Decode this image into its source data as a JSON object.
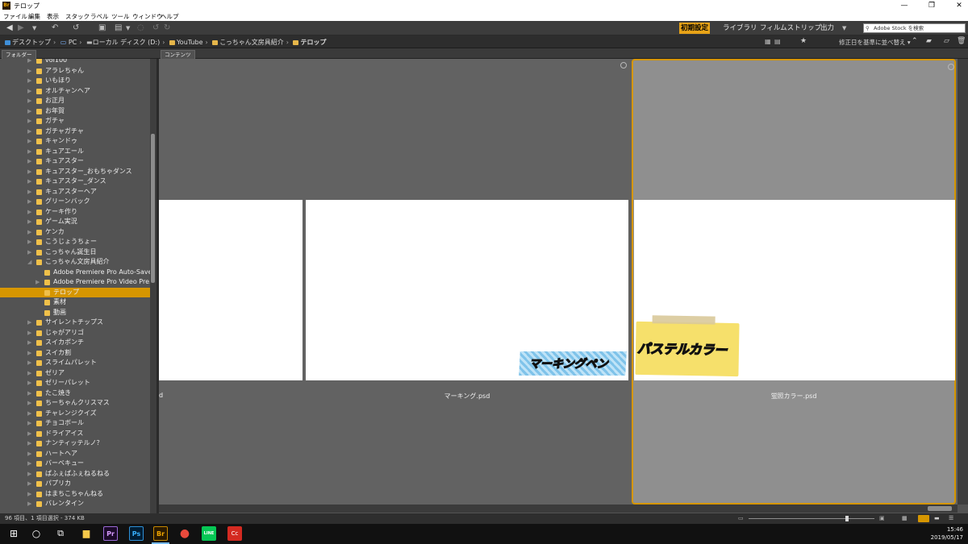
{
  "window": {
    "title": "テロップ",
    "app_icon_label": "Br",
    "controls": [
      "—",
      "❐",
      "✕"
    ]
  },
  "menu": [
    "ファイル",
    "編集",
    "表示",
    "スタック",
    "ラベル",
    "ツール",
    "ウィンドウ",
    "ヘルプ"
  ],
  "toolbar": {
    "workspaces": [
      "初期設定",
      "ライブラリ",
      "フィルムストリップ",
      "出力"
    ],
    "search_placeholder": "Adobe Stock を検索"
  },
  "breadcrumb": [
    "デスクトップ",
    "PC",
    "ローカル ディスク (D:)",
    "YouTube",
    "こっちゃん文房具紹介",
    "テロップ"
  ],
  "sort_label": "修正日を基準に並べ替え",
  "panels": {
    "folders_tab": "フォルダー",
    "content_tab": "コンテンツ"
  },
  "sidebar": {
    "items": [
      {
        "label": "vol100",
        "depth": 0,
        "expanded": false,
        "selected": false
      },
      {
        "label": "アラレちゃん",
        "depth": 0,
        "expanded": false,
        "selected": false
      },
      {
        "label": "いもほり",
        "depth": 0,
        "expanded": false,
        "selected": false
      },
      {
        "label": "オルチャンヘア",
        "depth": 0,
        "expanded": false,
        "selected": false
      },
      {
        "label": "お正月",
        "depth": 0,
        "expanded": false,
        "selected": false
      },
      {
        "label": "お年賀",
        "depth": 0,
        "expanded": false,
        "selected": false
      },
      {
        "label": "ガチャ",
        "depth": 0,
        "expanded": false,
        "selected": false
      },
      {
        "label": "ガチャガチャ",
        "depth": 0,
        "expanded": false,
        "selected": false
      },
      {
        "label": "キャンドゥ",
        "depth": 0,
        "expanded": false,
        "selected": false
      },
      {
        "label": "キュアエール",
        "depth": 0,
        "expanded": false,
        "selected": false
      },
      {
        "label": "キュアスター",
        "depth": 0,
        "expanded": false,
        "selected": false
      },
      {
        "label": "キュアスター_おもちゃダンス",
        "depth": 0,
        "expanded": false,
        "selected": false
      },
      {
        "label": "キュアスター_ダンス",
        "depth": 0,
        "expanded": false,
        "selected": false
      },
      {
        "label": "キュアスターヘア",
        "depth": 0,
        "expanded": false,
        "selected": false
      },
      {
        "label": "グリーンバック",
        "depth": 0,
        "expanded": false,
        "selected": false
      },
      {
        "label": "ケーキ作り",
        "depth": 0,
        "expanded": false,
        "selected": false
      },
      {
        "label": "ゲーム実況",
        "depth": 0,
        "expanded": false,
        "selected": false
      },
      {
        "label": "ケンカ",
        "depth": 0,
        "expanded": false,
        "selected": false
      },
      {
        "label": "こうじょうちょー",
        "depth": 0,
        "expanded": false,
        "selected": false
      },
      {
        "label": "こっちゃん誕生日",
        "depth": 0,
        "expanded": false,
        "selected": false
      },
      {
        "label": "こっちゃん文房具紹介",
        "depth": 0,
        "expanded": true,
        "selected": false
      },
      {
        "label": "Adobe Premiere Pro Auto-Save",
        "depth": 1,
        "expanded": false,
        "selected": false
      },
      {
        "label": "Adobe Premiere Pro Video Pre...",
        "depth": 1,
        "expanded": false,
        "selected": false
      },
      {
        "label": "テロップ",
        "depth": 1,
        "expanded": false,
        "selected": true
      },
      {
        "label": "素材",
        "depth": 1,
        "expanded": false,
        "selected": false
      },
      {
        "label": "動画",
        "depth": 1,
        "expanded": false,
        "selected": false
      },
      {
        "label": "サイレントチップス",
        "depth": 0,
        "expanded": false,
        "selected": false
      },
      {
        "label": "じゃがアリゴ",
        "depth": 0,
        "expanded": false,
        "selected": false
      },
      {
        "label": "スイカポンチ",
        "depth": 0,
        "expanded": false,
        "selected": false
      },
      {
        "label": "スイカ割",
        "depth": 0,
        "expanded": false,
        "selected": false
      },
      {
        "label": "スライムパレット",
        "depth": 0,
        "expanded": false,
        "selected": false
      },
      {
        "label": "ゼリア",
        "depth": 0,
        "expanded": false,
        "selected": false
      },
      {
        "label": "ゼリーパレット",
        "depth": 0,
        "expanded": false,
        "selected": false
      },
      {
        "label": "たこ焼き",
        "depth": 0,
        "expanded": false,
        "selected": false
      },
      {
        "label": "ちーちゃんクリスマス",
        "depth": 0,
        "expanded": false,
        "selected": false
      },
      {
        "label": "チャレンジクイズ",
        "depth": 0,
        "expanded": false,
        "selected": false
      },
      {
        "label": "チョコボール",
        "depth": 0,
        "expanded": false,
        "selected": false
      },
      {
        "label": "ドライアイス",
        "depth": 0,
        "expanded": false,
        "selected": false
      },
      {
        "label": "ナンティッテルノ？",
        "depth": 0,
        "expanded": false,
        "selected": false
      },
      {
        "label": "ハートヘア",
        "depth": 0,
        "expanded": false,
        "selected": false
      },
      {
        "label": "バーベキュー",
        "depth": 0,
        "expanded": false,
        "selected": false
      },
      {
        "label": "ぱふぇぱふぇねるねる",
        "depth": 0,
        "expanded": false,
        "selected": false
      },
      {
        "label": "パプリカ",
        "depth": 0,
        "expanded": false,
        "selected": false
      },
      {
        "label": "はまちこちゃんねる",
        "depth": 0,
        "expanded": false,
        "selected": false
      },
      {
        "label": "バレンタイン",
        "depth": 0,
        "expanded": false,
        "selected": false
      }
    ]
  },
  "content": {
    "items": [
      {
        "name": "d",
        "caption": "",
        "selected": false
      },
      {
        "name": "マーキング.psd",
        "caption": "マーキングペン",
        "selected": false
      },
      {
        "name": "蛍照カラー.psd",
        "caption": "パステルカラー",
        "selected": true
      }
    ]
  },
  "status": {
    "text": "96 項目、1 項目選択 - 374 KB",
    "thumbnail_size": 0.78
  },
  "taskbar": {
    "apps": [
      {
        "name": "start",
        "label": "⊞"
      },
      {
        "name": "search",
        "label": "○"
      },
      {
        "name": "task-view",
        "label": "⧉"
      },
      {
        "name": "explorer",
        "label": "▆"
      },
      {
        "name": "premiere",
        "label": "Pr"
      },
      {
        "name": "photoshop",
        "label": "Ps"
      },
      {
        "name": "bridge",
        "label": "Br"
      },
      {
        "name": "chrome",
        "label": "●"
      },
      {
        "name": "line",
        "label": "LINE"
      },
      {
        "name": "creative-cloud",
        "label": "Cc"
      }
    ],
    "time": "15:46",
    "date": "2019/05/17"
  }
}
